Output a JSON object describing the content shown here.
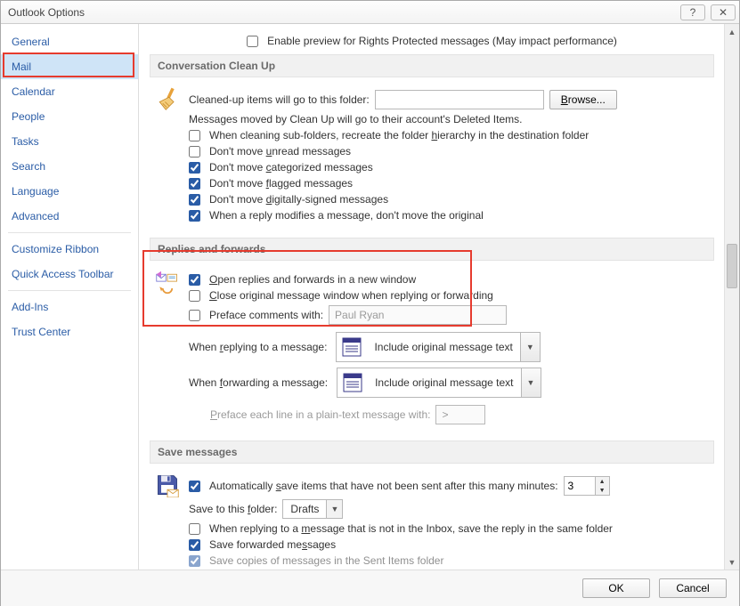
{
  "window": {
    "title": "Outlook Options"
  },
  "sidebar": {
    "items": [
      {
        "label": "General"
      },
      {
        "label": "Mail"
      },
      {
        "label": "Calendar"
      },
      {
        "label": "People"
      },
      {
        "label": "Tasks"
      },
      {
        "label": "Search"
      },
      {
        "label": "Language"
      },
      {
        "label": "Advanced"
      },
      {
        "label": "Customize Ribbon"
      },
      {
        "label": "Quick Access Toolbar"
      },
      {
        "label": "Add-Ins"
      },
      {
        "label": "Trust Center"
      }
    ]
  },
  "top": {
    "enable_preview": "Enable preview for Rights Protected messages (May impact performance)"
  },
  "cleanup": {
    "header": "Conversation Clean Up",
    "folder_label": "Cleaned-up items will go to this folder:",
    "folder_value": "",
    "browse": "Browse...",
    "moved_note": "Messages moved by Clean Up will go to their account's Deleted Items.",
    "c1": "When cleaning sub-folders, recreate the folder hierarchy in the destination folder",
    "c2": "Don't move unread messages",
    "c3": "Don't move categorized messages",
    "c4": "Don't move flagged messages",
    "c5": "Don't move digitally-signed messages",
    "c6": "When a reply modifies a message, don't move the original"
  },
  "replies": {
    "header": "Replies and forwards",
    "c1": "Open replies and forwards in a new window",
    "c2": "Close original message window when replying or forwarding",
    "preface_label": "Preface comments with:",
    "preface_value": "Paul Ryan",
    "reply_label": "When replying to a message:",
    "reply_select": "Include original message text",
    "forward_label": "When forwarding a message:",
    "forward_select": "Include original message text",
    "plain_label": "Preface each line in a plain-text message with:",
    "plain_value": ">"
  },
  "save": {
    "header": "Save messages",
    "autosave": "Automatically save items that have not been sent after this many minutes:",
    "autosave_value": "3",
    "folder_label": "Save to this folder:",
    "folder_value": "Drafts",
    "c1": "When replying to a message that is not in the Inbox, save the reply in the same folder",
    "c2": "Save forwarded messages",
    "c3": "Save copies of messages in the Sent Items folder"
  },
  "footer": {
    "ok": "OK",
    "cancel": "Cancel"
  }
}
